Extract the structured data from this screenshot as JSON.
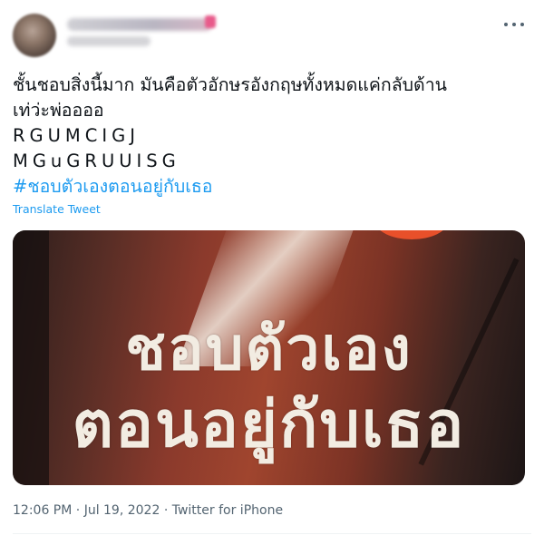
{
  "tweet": {
    "text_line1": "ชั้นชอบสิ่งนี้มาก มันคือตัวอักษรอังกฤษทั้งหมดแค่กลับด้าน",
    "text_line2": "เท่ว่ะพ่ออออ",
    "text_line3": "RGUMCIGJ",
    "text_line4": "MGuGRUUISG",
    "hashtag": "#ชอบตัวเองตอนอยู่กับเธอ",
    "translate_label": "Translate Tweet",
    "media": {
      "title_line1": "ชอบตัวเอง",
      "title_line2": "ตอนอยู่กับเธอ"
    },
    "time": "12:06 PM",
    "separator": "·",
    "date": "Jul 19, 2022",
    "source": "Twitter for iPhone",
    "more_icon": "more-horizontal-icon"
  }
}
